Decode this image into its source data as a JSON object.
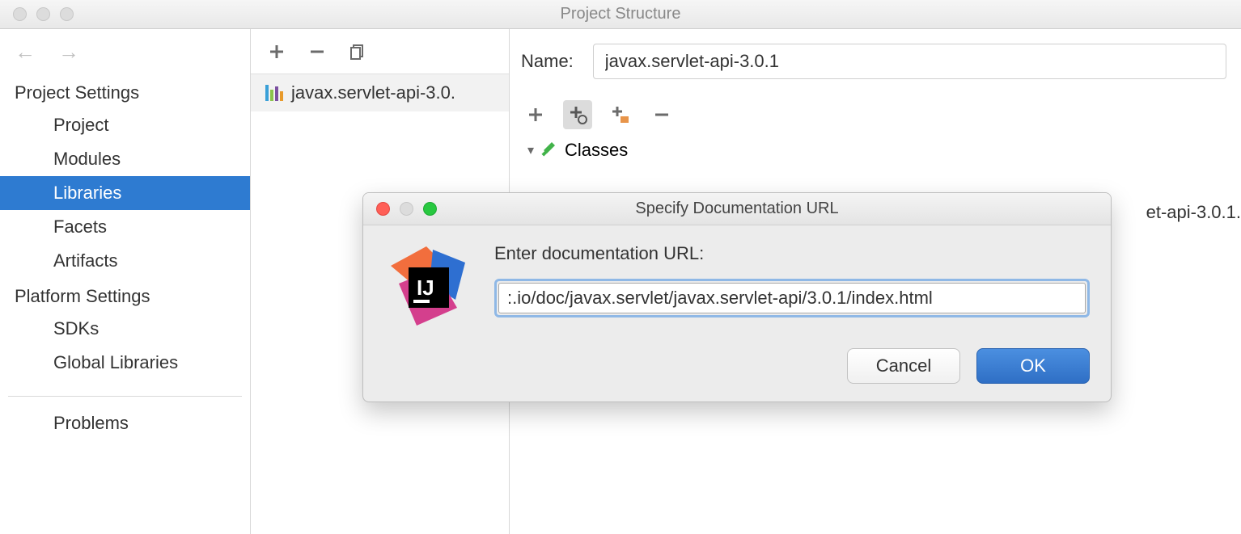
{
  "window": {
    "title": "Project Structure"
  },
  "sidebar": {
    "section1": "Project Settings",
    "items1": [
      "Project",
      "Modules",
      "Libraries",
      "Facets",
      "Artifacts"
    ],
    "section2": "Platform Settings",
    "items2": [
      "SDKs",
      "Global Libraries"
    ],
    "problems": "Problems",
    "selected": "Libraries"
  },
  "library_list": {
    "items": [
      "javax.servlet-api-3.0."
    ]
  },
  "details": {
    "name_label": "Name:",
    "name_value": "javax.servlet-api-3.0.1",
    "tree_root": "Classes",
    "tree_child_overflow": "et-api-3.0.1."
  },
  "dialog": {
    "title": "Specify Documentation URL",
    "prompt": "Enter documentation URL:",
    "input_value": ":.io/doc/javax.servlet/javax.servlet-api/3.0.1/index.html",
    "cancel": "Cancel",
    "ok": "OK"
  }
}
